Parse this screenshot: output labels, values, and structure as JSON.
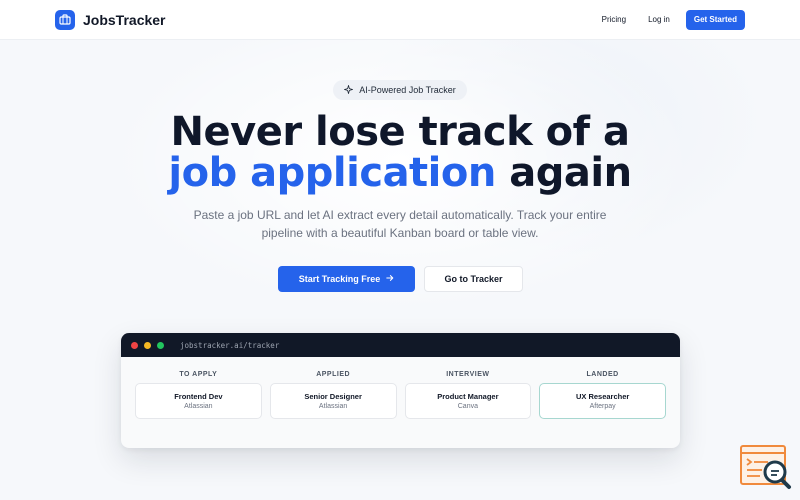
{
  "app": {
    "brand": "JobsTracker"
  },
  "nav": {
    "pricing": "Pricing",
    "login": "Log in",
    "get_started": "Get Started"
  },
  "hero": {
    "badge": "AI-Powered Job Tracker",
    "title_line1": "Never lose track of a",
    "title_accent": "job application",
    "title_after_accent": " again",
    "subtitle_line1": "Paste a job URL and let AI extract every detail automatically. Track your entire",
    "subtitle_line2": "pipeline with a beautiful Kanban board or table view.",
    "cta_primary": "Start Tracking Free",
    "cta_secondary": "Go to Tracker"
  },
  "preview": {
    "url": "jobstracker.ai/tracker",
    "columns": [
      {
        "title": "TO APPLY",
        "card": {
          "role": "Frontend Dev",
          "company": "Atlassian"
        }
      },
      {
        "title": "APPLIED",
        "card": {
          "role": "Senior Designer",
          "company": "Atlassian"
        }
      },
      {
        "title": "INTERVIEW",
        "card": {
          "role": "Product Manager",
          "company": "Canva"
        }
      },
      {
        "title": "LANDED",
        "card": {
          "role": "UX Researcher",
          "company": "Afterpay"
        }
      }
    ]
  },
  "colors": {
    "accent": "#2563eb",
    "dark": "#0f172a",
    "dot_red": "#ef4444",
    "dot_yellow": "#f5b823",
    "dot_green": "#22c55e"
  },
  "icons": {
    "logo": "briefcase-icon",
    "badge": "sparkle-icon",
    "cta_primary": "arrow-right-icon",
    "widget": "search-document-icon"
  }
}
